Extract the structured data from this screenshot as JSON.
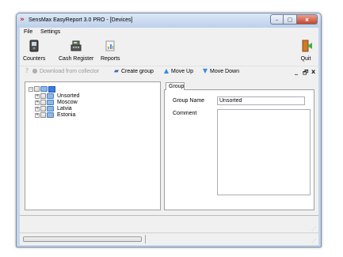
{
  "window": {
    "title": "SensMax EasyReport 3.0 PRO - [Devices]",
    "controls": {
      "minimize": "–",
      "maximize": "▢",
      "close": "x"
    }
  },
  "menu": {
    "items": [
      "File",
      "Settings"
    ]
  },
  "ribbon": {
    "buttons": [
      {
        "label": "Counters",
        "icon": "counter-device-icon"
      },
      {
        "label": "Cash Register",
        "icon": "cash-register-icon"
      },
      {
        "label": "Reports",
        "icon": "reports-icon"
      }
    ],
    "quit": {
      "label": "Quit",
      "icon": "exit-door-icon"
    }
  },
  "toolbar": {
    "download_label": "Download from collector",
    "create_group_label": "Create group",
    "move_up_label": "Move Up",
    "move_down_label": "Move Down",
    "mdi_min": "_",
    "mdi_restore": "🗗",
    "mdi_close": "x"
  },
  "tree": {
    "items": [
      {
        "label": "Unsorted",
        "expanded": false
      },
      {
        "label": "Moscow",
        "expanded": false
      },
      {
        "label": "Latvia",
        "expanded": false
      },
      {
        "label": "Estonia",
        "expanded": false
      }
    ]
  },
  "group_panel": {
    "tab_label": "Group",
    "group_name_label": "Group Name",
    "group_name_value": "Unsorted",
    "comment_label": "Comment",
    "comment_value": ""
  },
  "colors": {
    "accent": "#3d7be0",
    "title_gradient_top": "#dce8f6",
    "close_button": "#c9452c"
  }
}
